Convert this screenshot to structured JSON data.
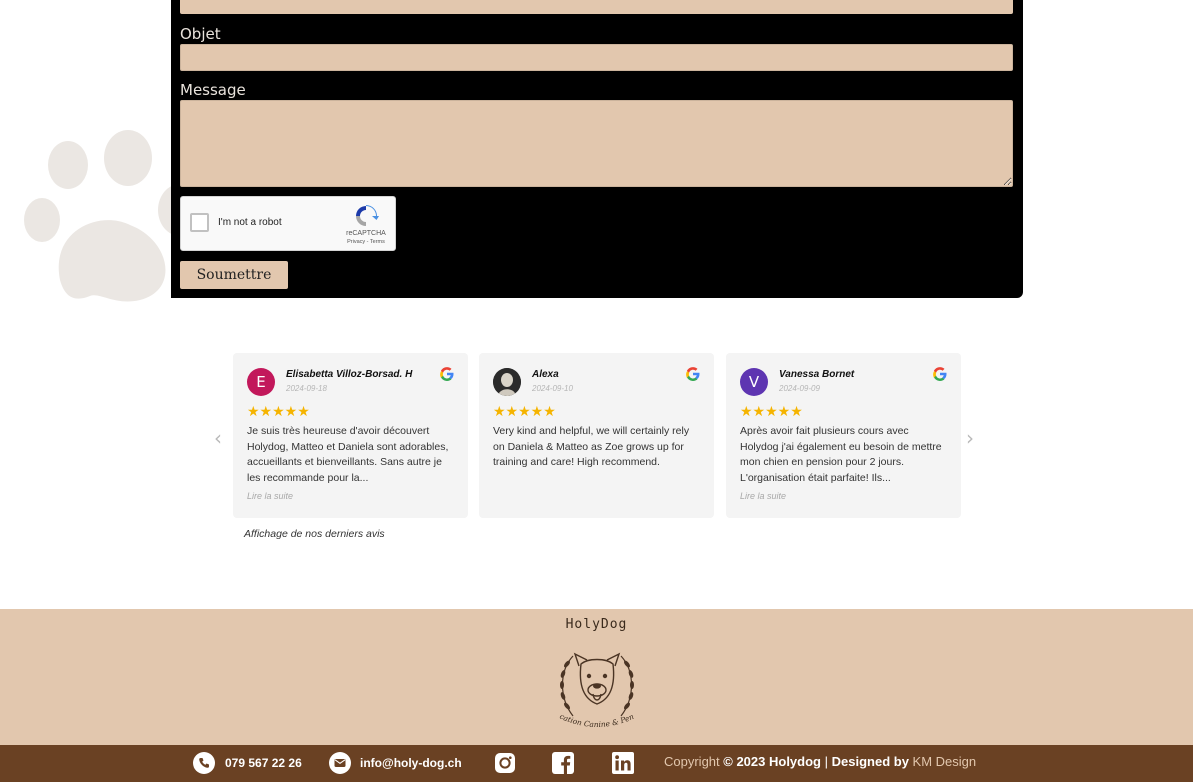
{
  "form": {
    "subject_label": "Objet",
    "message_label": "Message",
    "captcha": {
      "label": "I'm not a robot",
      "brand": "reCAPTCHA",
      "terms": "Privacy - Terms"
    },
    "submit_label": "Soumettre"
  },
  "reviews": {
    "items": [
      {
        "initial": "E",
        "avatar_color": "#c2185b",
        "name": "Elisabetta Villoz-Borsad. H",
        "date": "2024-09-18",
        "stars": "★★★★★",
        "text": "Je suis très heureuse d'avoir découvert Holydog, Matteo et Daniela sont adorables, accueillants et bienveillants. Sans autre je les recommande pour la...",
        "read_more": "Lire la suite"
      },
      {
        "initial": "",
        "avatar_color": "#d9d4c9",
        "name": "Alexa",
        "date": "2024-09-10",
        "stars": "★★★★★",
        "text": "Very kind and helpful, we will certainly rely on Daniela & Matteo as Zoe grows up for training and care! High recommend.",
        "read_more": ""
      },
      {
        "initial": "V",
        "avatar_color": "#5e35b1",
        "name": "Vanessa Bornet",
        "date": "2024-09-09",
        "stars": "★★★★★",
        "text": "Après avoir fait plusieurs cours avec Holydog j'ai également eu besoin de mettre mon chien en pension pour 2 jours. L'organisation était parfaite! Ils...",
        "read_more": "Lire la suite"
      }
    ],
    "prev_arrow": "‹",
    "next_arrow": "›",
    "footer_note": "Affichage de nos derniers avis"
  },
  "footer": {
    "brand": "HolyDog",
    "emblem_text": "Education Canine & Pension",
    "phone": "079 567 22 26",
    "email": "info@holy-dog.ch",
    "copyright_prefix": "Copyright",
    "copyright_main": "© 2023 Holydog",
    "copyright_sep": "|",
    "designed_by": "Designed by",
    "designer": "KM Design"
  },
  "colors": {
    "accent_beige": "#e2c7ae",
    "footer_brown": "#6a4123",
    "star_gold": "#f5b400"
  },
  "icons": [
    "paw-icon",
    "google-icon",
    "phone-icon",
    "mail-icon",
    "instagram-icon",
    "facebook-icon",
    "linkedin-icon"
  ]
}
